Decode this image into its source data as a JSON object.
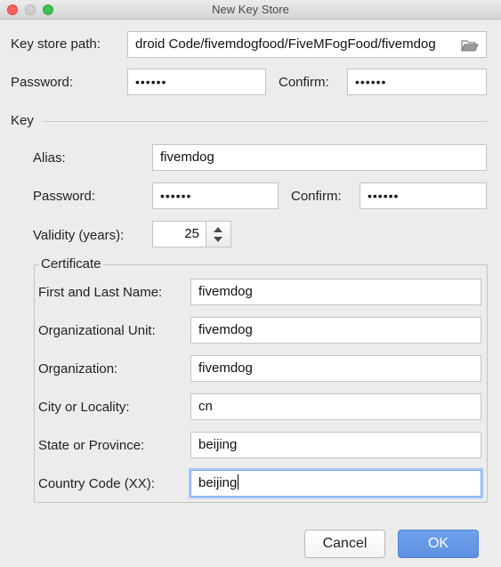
{
  "window": {
    "title": "New Key Store"
  },
  "keystore": {
    "path_label": "Key store path:",
    "path_value": "droid Code/fivemdogfood/FiveMFogFood/fivemdog",
    "password_label": "Password:",
    "password_value": "••••••",
    "confirm_label": "Confirm:",
    "confirm_value": "••••••"
  },
  "key": {
    "section_label": "Key",
    "alias_label": "Alias:",
    "alias_value": "fivemdog",
    "password_label": "Password:",
    "password_value": "••••••",
    "confirm_label": "Confirm:",
    "confirm_value": "••••••",
    "validity_label": "Validity (years):",
    "validity_value": "25"
  },
  "certificate": {
    "group_label": "Certificate",
    "fields": [
      {
        "label": "First and Last Name:",
        "value": "fivemdog"
      },
      {
        "label": "Organizational Unit:",
        "value": "fivemdog"
      },
      {
        "label": "Organization:",
        "value": "fivemdog"
      },
      {
        "label": "City or Locality:",
        "value": "cn"
      },
      {
        "label": "State or Province:",
        "value": "beijing"
      },
      {
        "label": "Country Code (XX):",
        "value": "beijing"
      }
    ]
  },
  "buttons": {
    "cancel": "Cancel",
    "ok": "OK"
  },
  "colors": {
    "accent": "#6498e6",
    "focus_ring": "#a9c8f4"
  }
}
